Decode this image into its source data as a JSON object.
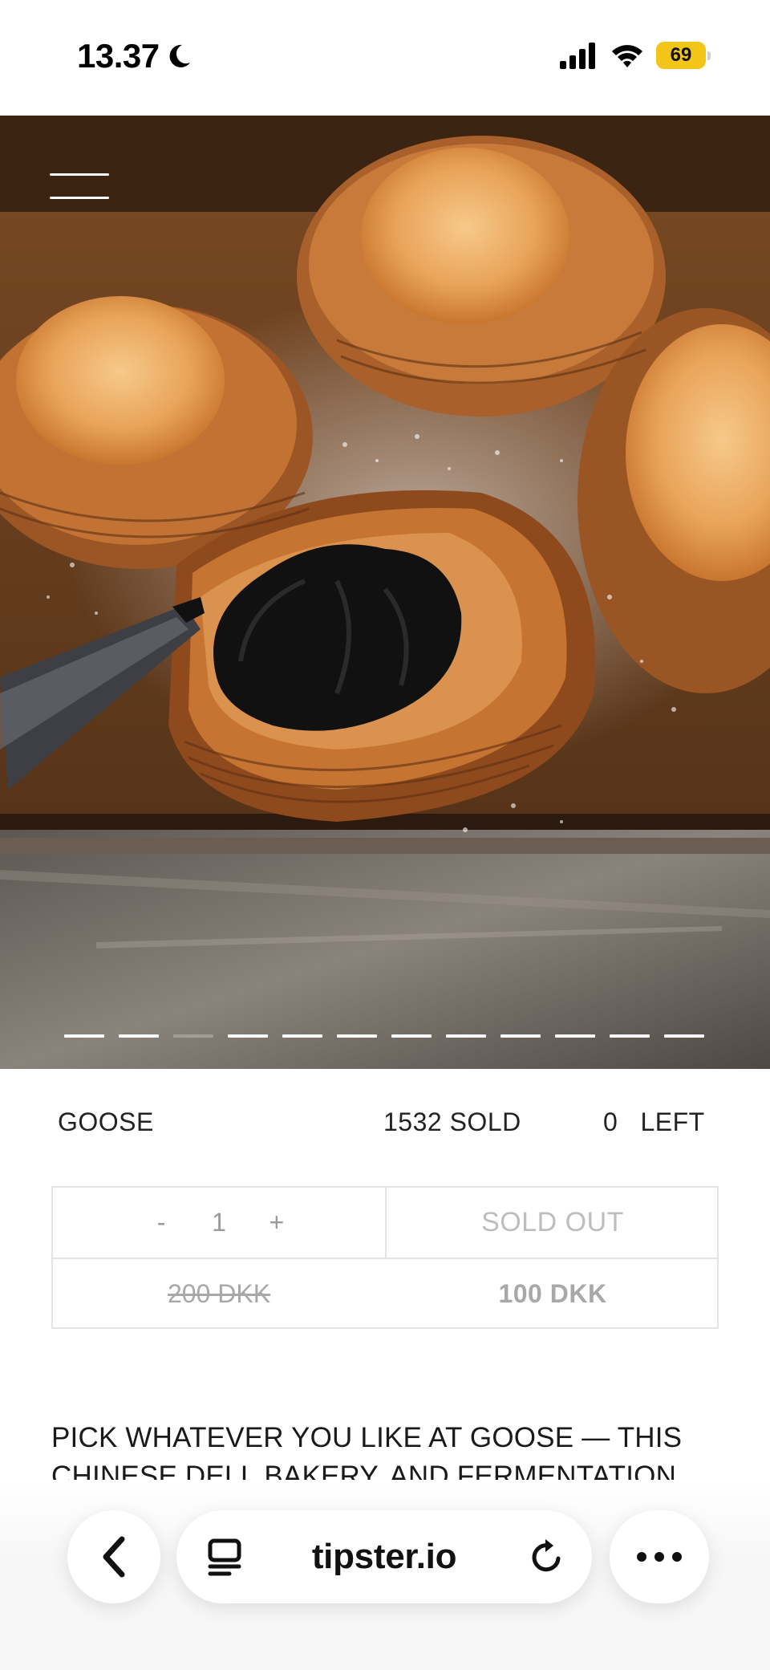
{
  "status_bar": {
    "time": "13.37",
    "battery": "69",
    "icons": [
      "moon-icon",
      "signal-icon",
      "wifi-icon",
      "battery-icon"
    ]
  },
  "hero": {
    "image": "danish-pastries-photo",
    "carousel": {
      "total": 12,
      "active_index": 2
    }
  },
  "product": {
    "name": "GOOSE",
    "sold": "1532 SOLD",
    "left_count": "0",
    "left_label": "LEFT"
  },
  "purchase": {
    "minus": "-",
    "quantity": "1",
    "plus": "+",
    "status": "SOLD OUT",
    "old_price": "200 DKK",
    "new_price": "100 DKK"
  },
  "description": {
    "line1": "PICK WHATEVER YOU LIKE AT GOOSE — THIS",
    "line2": "CHINESE DELI, BAKERY, AND FERMENTATION"
  },
  "browser": {
    "url": "tipster.io",
    "icons": [
      "chevron-left-icon",
      "tabs-icon",
      "reload-icon",
      "more-icon"
    ]
  }
}
